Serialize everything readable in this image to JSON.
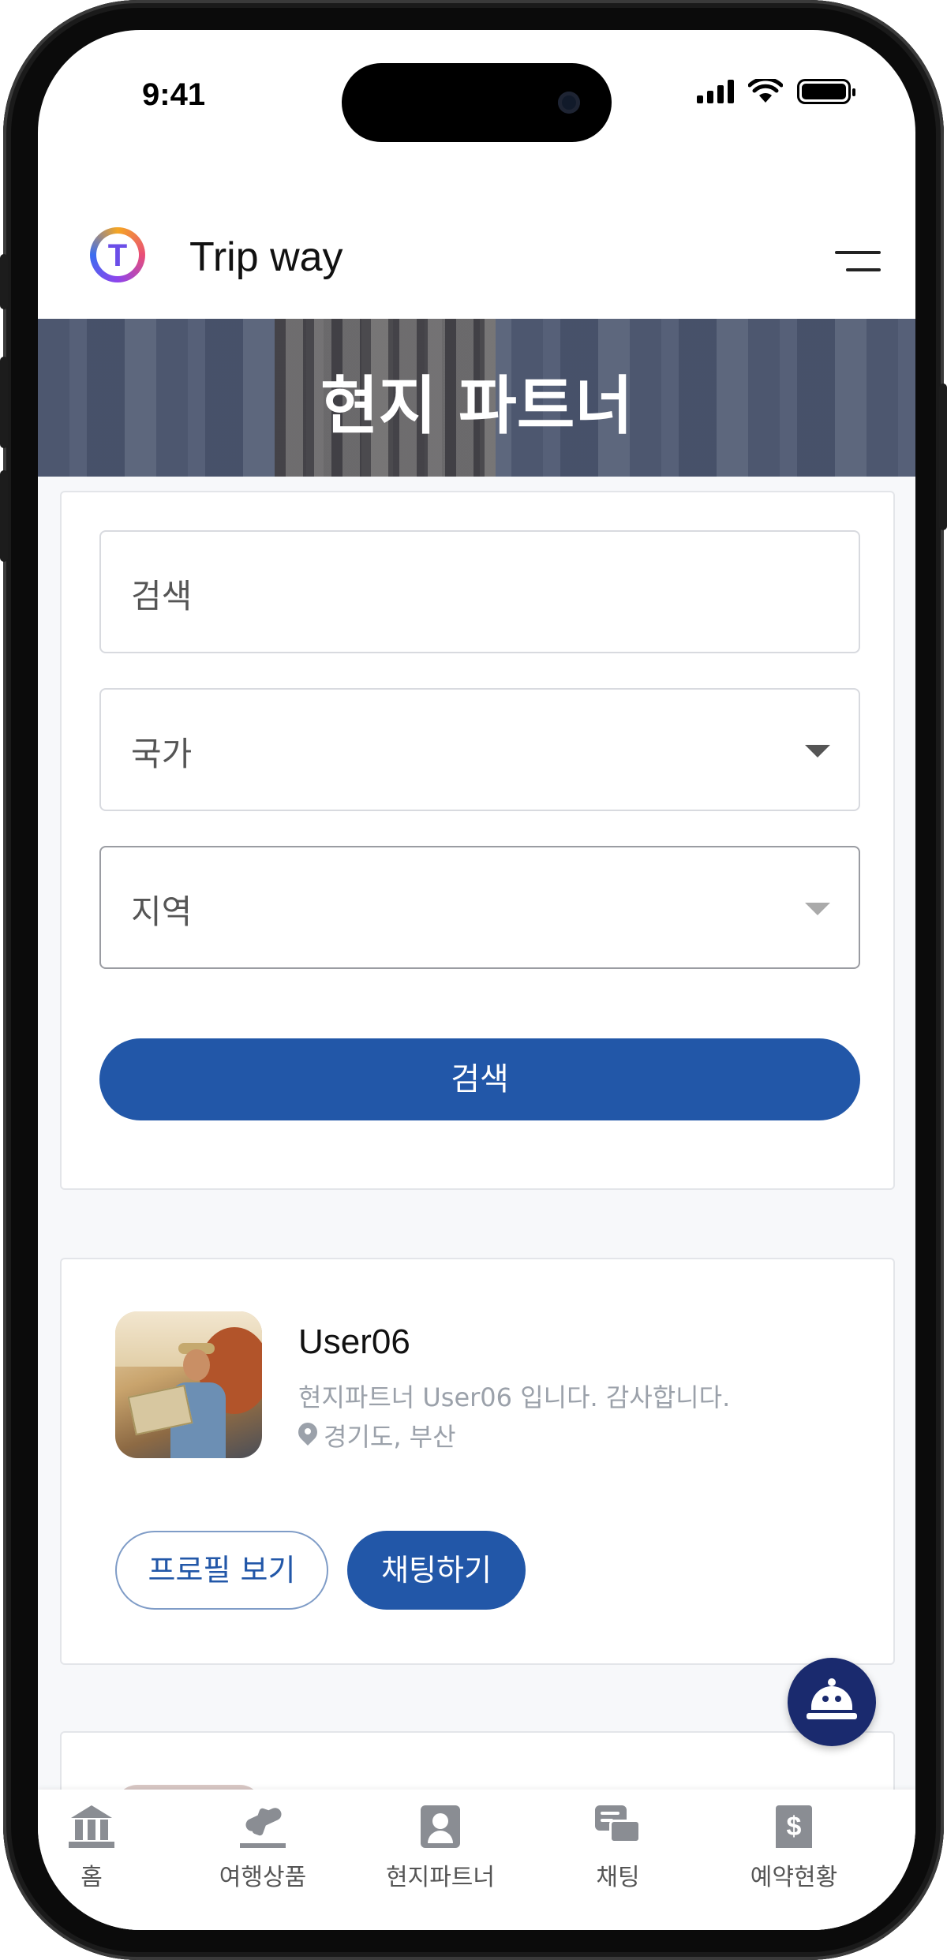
{
  "status_bar": {
    "time": "9:41"
  },
  "header": {
    "app_title": "Trip way",
    "logo_letter": "T"
  },
  "hero": {
    "title": "현지 파트너"
  },
  "search_form": {
    "search_placeholder": "검색",
    "country_placeholder": "국가",
    "region_placeholder": "지역",
    "submit_label": "검색"
  },
  "partners": [
    {
      "name": "User06",
      "description": "현지파트너 User06 입니다. 감사합니다.",
      "location": "경기도, 부산",
      "view_profile_label": "프로필 보기",
      "chat_label": "채팅하기"
    }
  ],
  "bottom_nav": {
    "items": [
      {
        "label": "홈",
        "icon": "home-icon"
      },
      {
        "label": "여행상품",
        "icon": "plane-icon"
      },
      {
        "label": "현지파트너",
        "icon": "person-card-icon"
      },
      {
        "label": "채팅",
        "icon": "chat-icon"
      },
      {
        "label": "예약현황",
        "icon": "receipt-icon"
      }
    ]
  },
  "colors": {
    "primary": "#2257a8",
    "fab": "#1a2a6e",
    "muted_text": "#9ba1aa"
  }
}
